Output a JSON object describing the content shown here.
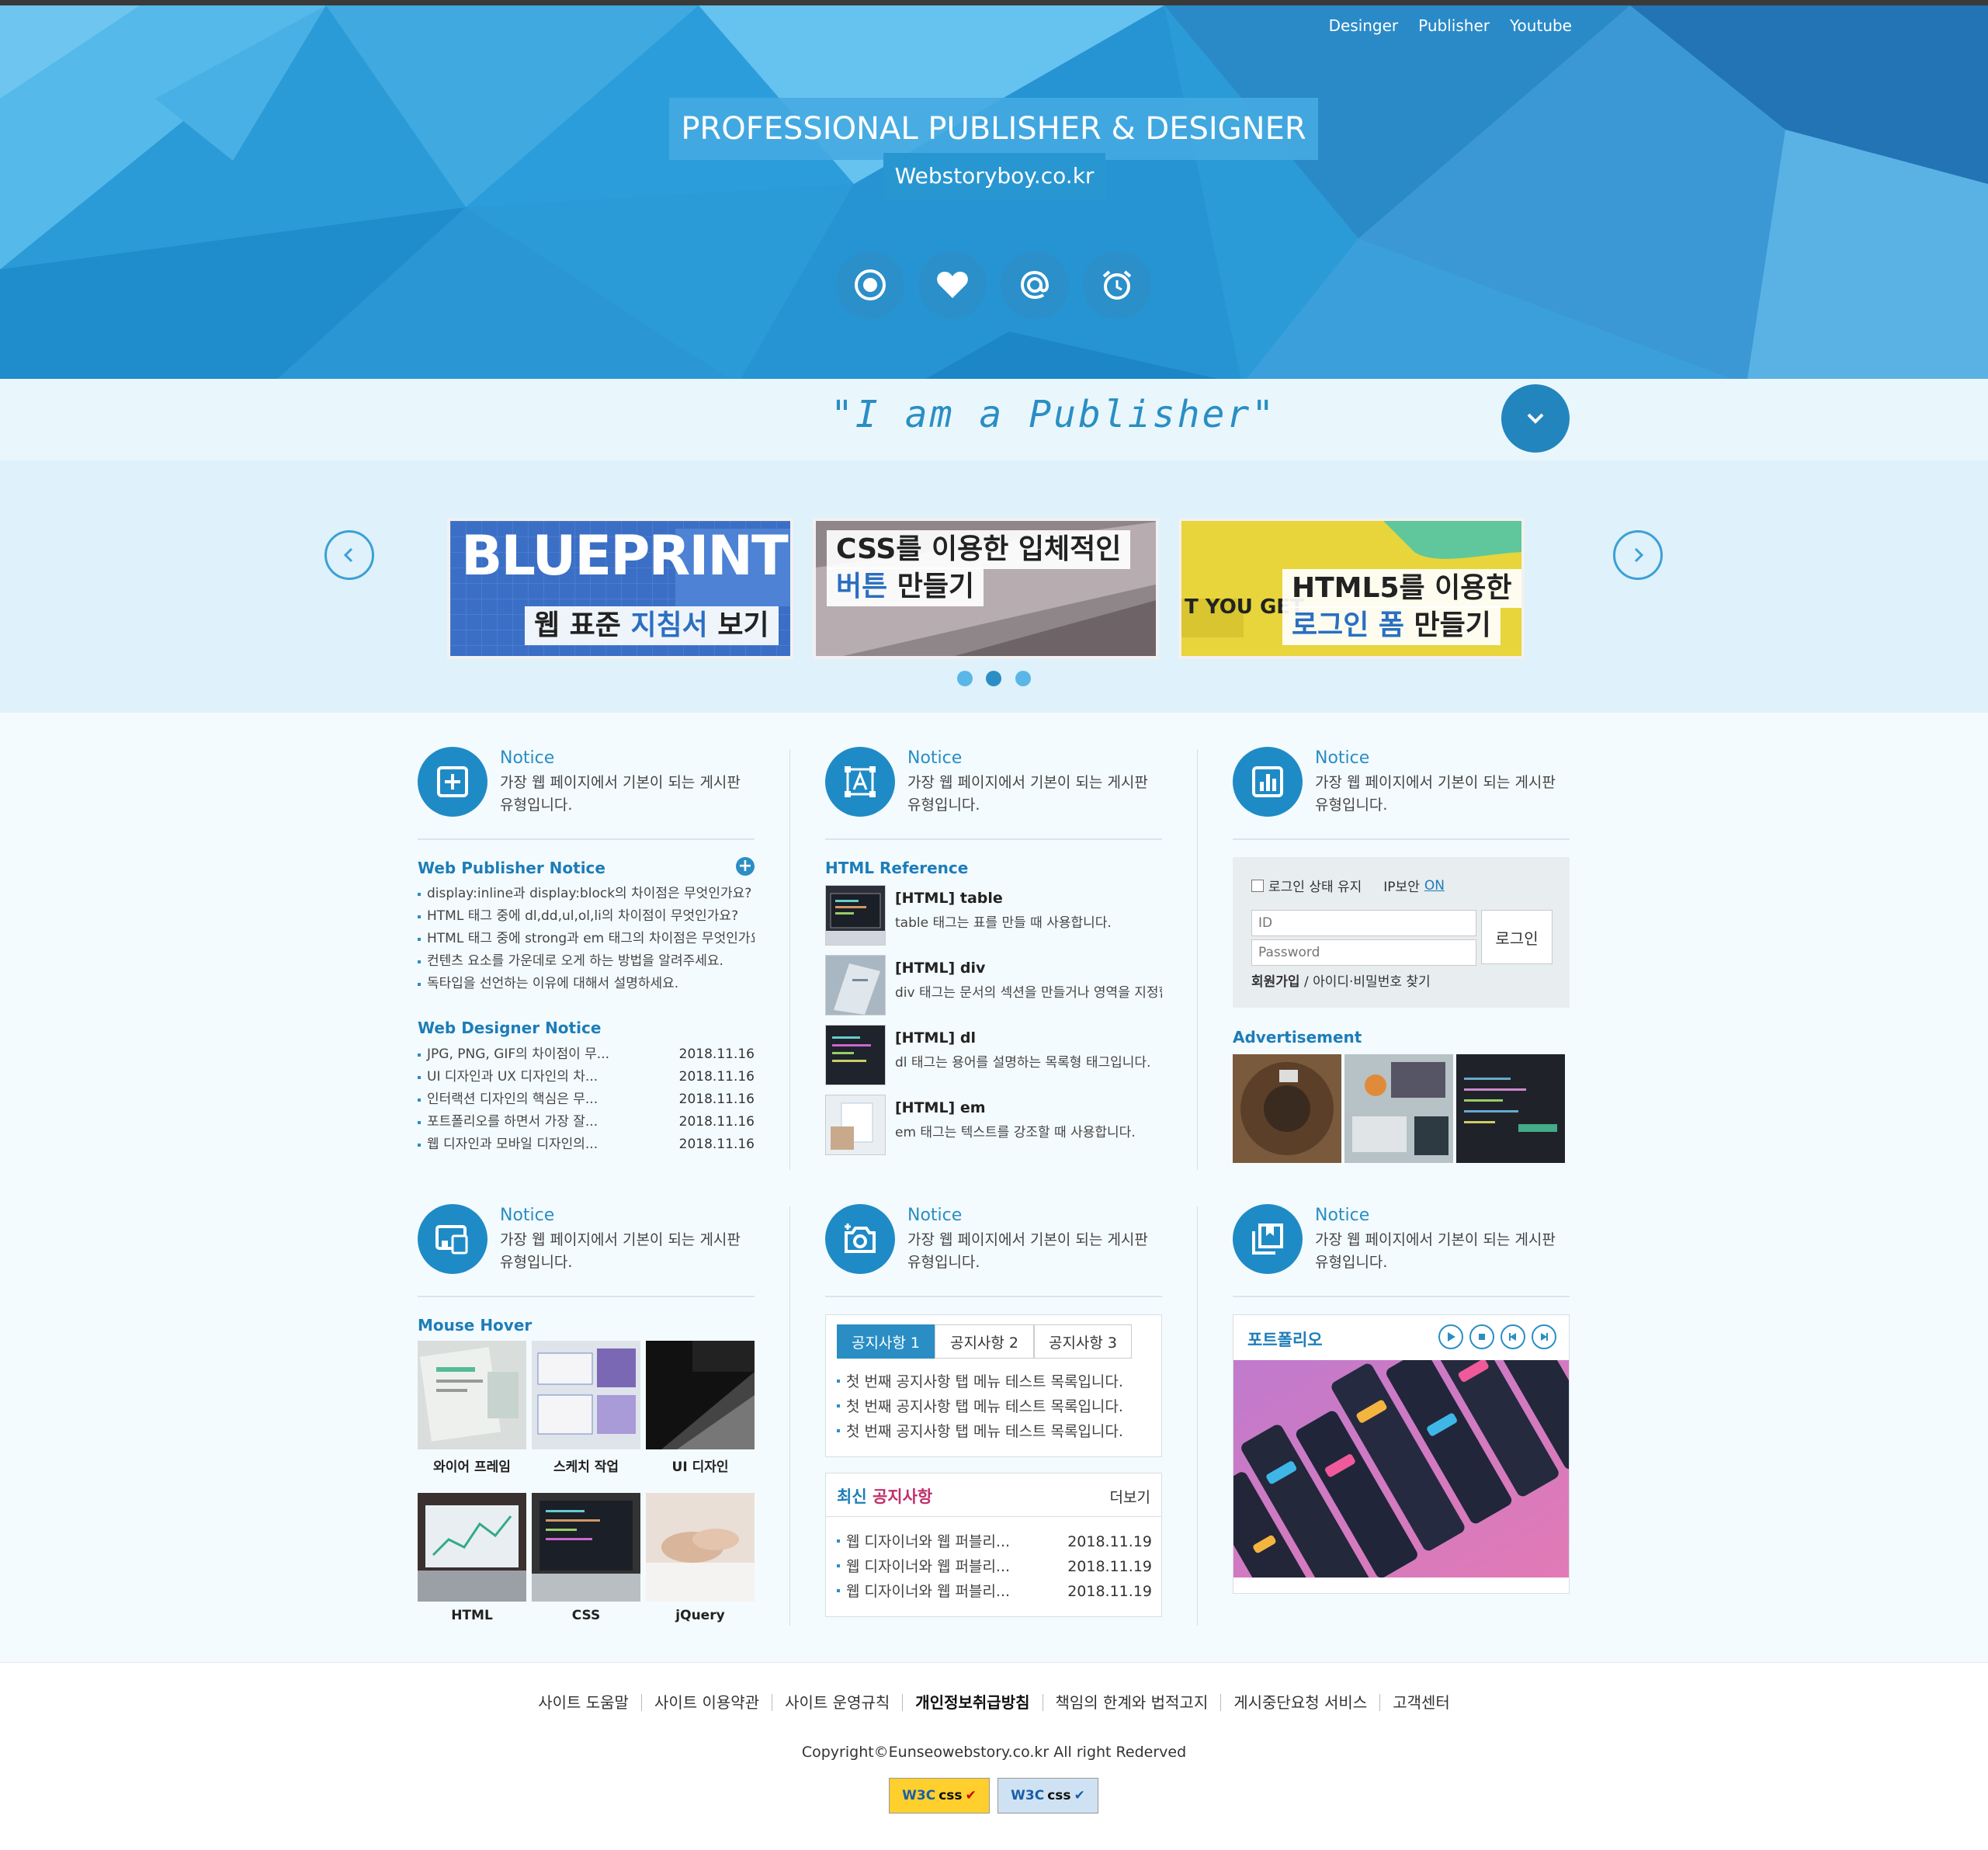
{
  "hero": {
    "nav": [
      "Desinger",
      "Publisher",
      "Youtube"
    ],
    "title": "PROFESSIONAL PUBLISHER & DESIGNER",
    "subtitle": "Webstoryboy.co.kr",
    "icons": [
      "record-icon",
      "heart-icon",
      "at-icon",
      "alarm-clock-icon"
    ]
  },
  "tagline": "\"I am a Publisher\"",
  "slider": {
    "slides": [
      {
        "big": "BLUEPRINTS",
        "line1_a": "웹 표준 ",
        "line1_hl": "지침서",
        "line1_b": " 보기"
      },
      {
        "line1": "CSS를 이용한 입체적인",
        "line2_hl": "버튼",
        "line2_b": " 만들기"
      },
      {
        "side": "T YOU GET",
        "line1": "HTML5를 이용한",
        "line2_hl": "로그인 폼",
        "line2_b": " 만들기"
      }
    ],
    "active_dot": 1
  },
  "notice": {
    "title": "Notice",
    "desc": "가장 웹 페이지에서 기본이 되는 게시판 유형입니다."
  },
  "web_publisher": {
    "title": "Web Publisher Notice",
    "items": [
      "display:inline과 display:block의 차이점은 무엇인가요?",
      "HTML 태그 중에 dl,dd,ul,ol,li의 차이점이 무엇인가요?",
      "HTML 태그 중에 strong과 em 태그의 차이점은 무엇인가요?",
      "컨텐츠 요소를 가운데로 오게 하는 방법을 알려주세요.",
      "독타입을 선언하는 이유에 대해서 설명하세요."
    ]
  },
  "web_designer": {
    "title": "Web Designer Notice",
    "items": [
      {
        "text": "JPG, PNG, GIF의 차이점이 무...",
        "date": "2018.11.16"
      },
      {
        "text": "UI 디자인과 UX 디자인의 차...",
        "date": "2018.11.16"
      },
      {
        "text": "인터랙션 디자인의 핵심은 무...",
        "date": "2018.11.16"
      },
      {
        "text": "포트폴리오를 하면서 가장 잘...",
        "date": "2018.11.16"
      },
      {
        "text": "웹 디자인과 모바일 디자인의...",
        "date": "2018.11.16"
      }
    ]
  },
  "html_reference": {
    "title_a": "HTML",
    "title_b": " Reference",
    "items": [
      {
        "title": "[HTML] table",
        "desc": "table 태그는 표를 만들 때 사용합니다."
      },
      {
        "title": "[HTML] div",
        "desc": "div 태그는 문서의 섹션을 만들거나 영역을 지정합니다."
      },
      {
        "title": "[HTML] dl",
        "desc": "dl 태그는 용어를 설명하는 목록형 태그입니다."
      },
      {
        "title": "[HTML] em",
        "desc": "em 태그는 텍스트를 강조할 때 사용합니다."
      }
    ]
  },
  "login": {
    "keep": "로그인 상태 유지",
    "ip": "IP보안",
    "ip_state": "ON",
    "id_placeholder": "ID",
    "pw_placeholder": "Password",
    "button": "로그인",
    "join": "회원가입",
    "find": " / 아이디·비밀번호 찾기"
  },
  "advertisement": {
    "title": "Advertisement"
  },
  "mouse_hover": {
    "title": "Mouse Hover",
    "items": [
      "와이어 프레임",
      "스케치 작업",
      "UI 디자인",
      "HTML",
      "CSS",
      "jQuery"
    ]
  },
  "tabs": {
    "labels": [
      "공지사항 1",
      "공지사항 2",
      "공지사항 3"
    ],
    "items": [
      "첫 번째 공지사항 탭 메뉴 테스트 목록입니다.",
      "첫 번째 공지사항 탭 메뉴 테스트 목록입니다.",
      "첫 번째 공지사항 탭 메뉴 테스트 목록입니다."
    ]
  },
  "recent": {
    "title_a": "최신",
    "title_b": "공지사항",
    "more": "더보기",
    "items": [
      {
        "text": "웹 디자이너와 웹 퍼블리...",
        "date": "2018.11.19"
      },
      {
        "text": "웹 디자이너와 웹 퍼블리...",
        "date": "2018.11.19"
      },
      {
        "text": "웹 디자이너와 웹 퍼블리...",
        "date": "2018.11.19"
      }
    ]
  },
  "portfolio": {
    "title": "포트폴리오"
  },
  "footer": {
    "links": [
      "사이트 도움말",
      "사이트 이용약관",
      "사이트 운영규칙",
      "개인정보취급방침",
      "책임의 한계와 법적고지",
      "게시중단요청 서비스",
      "고객센터"
    ],
    "bold_index": 3,
    "copyright": "Copyright©Eunseowebstory.co.kr All right Rederved",
    "badges": [
      {
        "w3c": "W3C",
        "label": "css"
      },
      {
        "w3c": "W3C",
        "label": "css"
      }
    ]
  },
  "colors": {
    "primary": "#2a8ec4",
    "dark_blue": "#1d7db8",
    "hero_bg": "#2a9bd6",
    "pink": "#c0306b"
  }
}
